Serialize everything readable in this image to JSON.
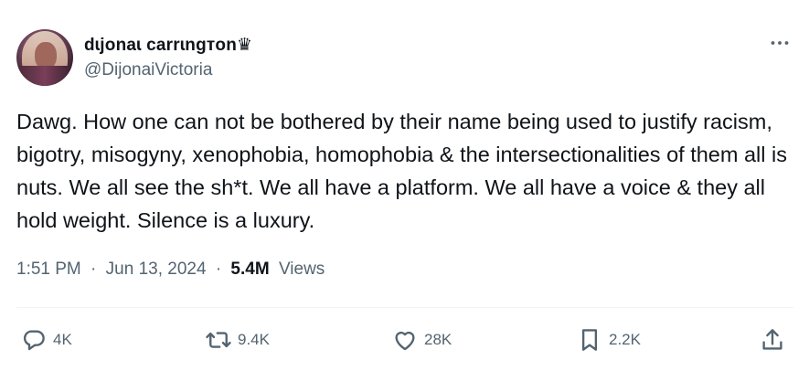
{
  "author": {
    "display_name": "dɩjonaɩ carrɩngтon♛",
    "handle": "@DijonaiVictoria"
  },
  "tweet": {
    "text": "Dawg. How one can not be bothered by their name being used to justify racism, bigotry, misogyny, xenophobia, homophobia & the intersectionalities of them all is nuts. We all see the sh*t. We all have a platform. We all have a voice & they all hold weight. Silence is a luxury.",
    "time": "1:51 PM",
    "separator": "·",
    "date": "Jun 13, 2024",
    "views_count": "5.4M",
    "views_label": "Views"
  },
  "actions": {
    "replies": "4K",
    "retweets": "9.4K",
    "likes": "28K",
    "bookmarks": "2.2K"
  },
  "icons": {
    "more": "more-horizontal-icon",
    "reply": "reply-bubble-icon",
    "retweet": "retweet-icon",
    "like": "heart-icon",
    "bookmark": "bookmark-icon",
    "share": "share-upload-icon"
  },
  "colors": {
    "text_primary": "#0f1419",
    "text_secondary": "#536471",
    "divider": "#eff3f4",
    "background": "#ffffff"
  }
}
